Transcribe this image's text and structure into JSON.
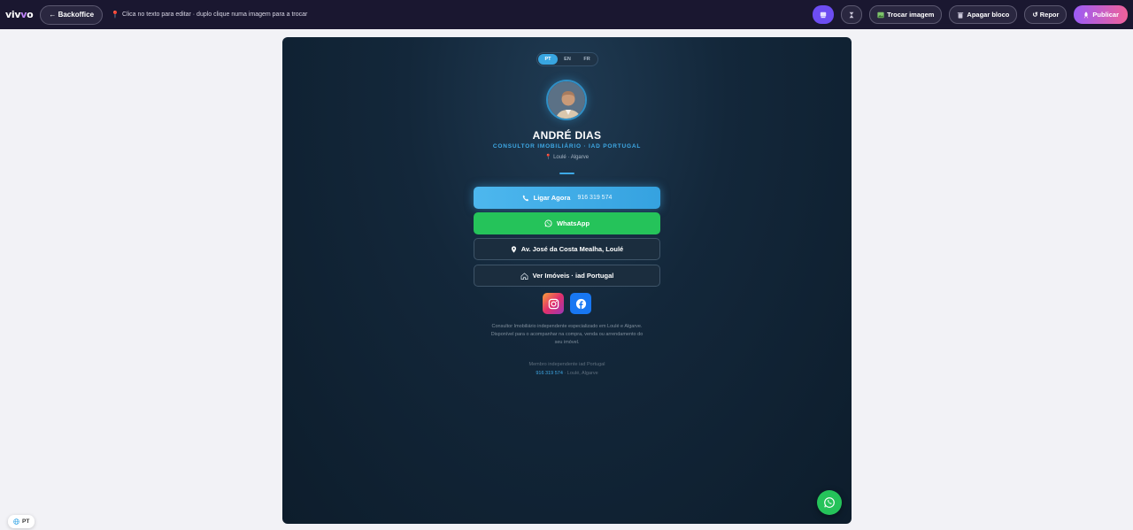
{
  "topbar": {
    "logo_a": "viv",
    "logo_b": "v",
    "logo_c": "o",
    "back_label": "← Backoffice",
    "hint": "Clica no texto para editar · duplo clique numa imagem para a trocar",
    "swap_image_label": "Trocar imagem",
    "delete_block_label": "Apagar bloco",
    "reset_label": "↺ Repor",
    "publish_label": "Publicar"
  },
  "profile": {
    "languages": [
      "PT",
      "EN",
      "FR"
    ],
    "active_language": "PT",
    "name": "ANDRÉ DIAS",
    "role": "CONSULTOR IMOBILIÁRIO · IAD PORTUGAL",
    "location": "Loulé · Algarve"
  },
  "actions": {
    "call_label": "Ligar Agora",
    "call_number": "916 319 574",
    "whatsapp_label": "WhatsApp",
    "address_label": "Av. José da Costa Mealha, Loulé",
    "properties_label": "Ver Imóveis · iad Portugal"
  },
  "bio": "Consultor Imobiliário independente especializado em Loulé e Algarve. Disponível para o acompanhar na compra, venda ou arrendamento do seu imóvel.",
  "footer": {
    "member": "Membro independente iad Portugal",
    "phone": "916 319 574",
    "place": " · Loulé, Algarve"
  },
  "lang_chip": "PT",
  "colors": {
    "accent": "#3ea9e6",
    "whatsapp": "#25c35a",
    "publish_start": "#9b5cf6",
    "publish_end": "#f0619a",
    "card_bg": "#13273a",
    "topbar_bg": "#1a1730"
  }
}
